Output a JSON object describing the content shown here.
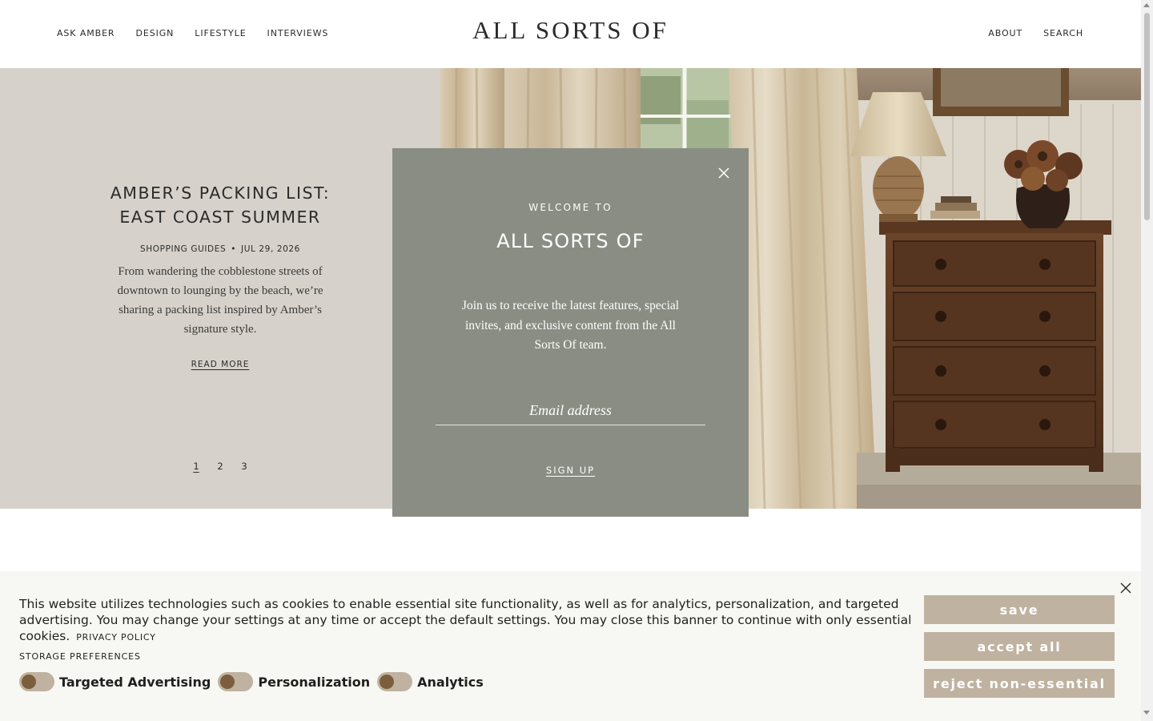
{
  "header": {
    "nav_left": [
      "ASK AMBER",
      "DESIGN",
      "LIFESTYLE",
      "INTERVIEWS"
    ],
    "logo": "ALL SORTS OF",
    "nav_right": [
      "ABOUT",
      "SEARCH"
    ]
  },
  "hero": {
    "title_line1": "AMBER’S PACKING LIST:",
    "title_line2": "EAST COAST SUMMER",
    "category": "SHOPPING GUIDES",
    "separator": "•",
    "date": "JUL 29, 2026",
    "excerpt": "From wandering the cobblestone streets of downtown to lounging by the beach, we’re sharing a packing list inspired by Amber’s signature style.",
    "read_more": "READ MORE",
    "pages": [
      "1",
      "2",
      "3"
    ],
    "active_page": "1"
  },
  "modal": {
    "eyebrow": "WELCOME TO",
    "title": "ALL SORTS OF",
    "body": "Join us to receive the latest features, special invites, and exclusive content from the All Sorts Of team.",
    "email_placeholder": "Email address",
    "signup_label": "SIGN UP"
  },
  "cookie_banner": {
    "text": "This website utilizes technologies such as cookies to enable essential site functionality, as well as for analytics, personalization, and targeted advertising. You may change your settings at any time or accept the default settings. You may close this banner to continue with only essential cookies.",
    "privacy_link": "PRIVACY POLICY",
    "storage_heading": "STORAGE PREFERENCES",
    "toggles": [
      {
        "label": "Targeted Advertising",
        "on": false
      },
      {
        "label": "Personalization",
        "on": false
      },
      {
        "label": "Analytics",
        "on": false
      }
    ],
    "buttons": {
      "save": "save",
      "accept_all": "accept all",
      "reject": "reject non-essential"
    }
  },
  "colors": {
    "hero_panel": "#d6d2cb",
    "modal_bg": "#8a8d83",
    "cookie_bg": "#f7f8f3",
    "cookie_button": "#bfb2a0",
    "toggle_knob": "#7b5e3d"
  },
  "icons": {
    "modal_close": "close-icon",
    "cookie_close": "close-icon",
    "carousel_next": "chevron-right-icon"
  }
}
